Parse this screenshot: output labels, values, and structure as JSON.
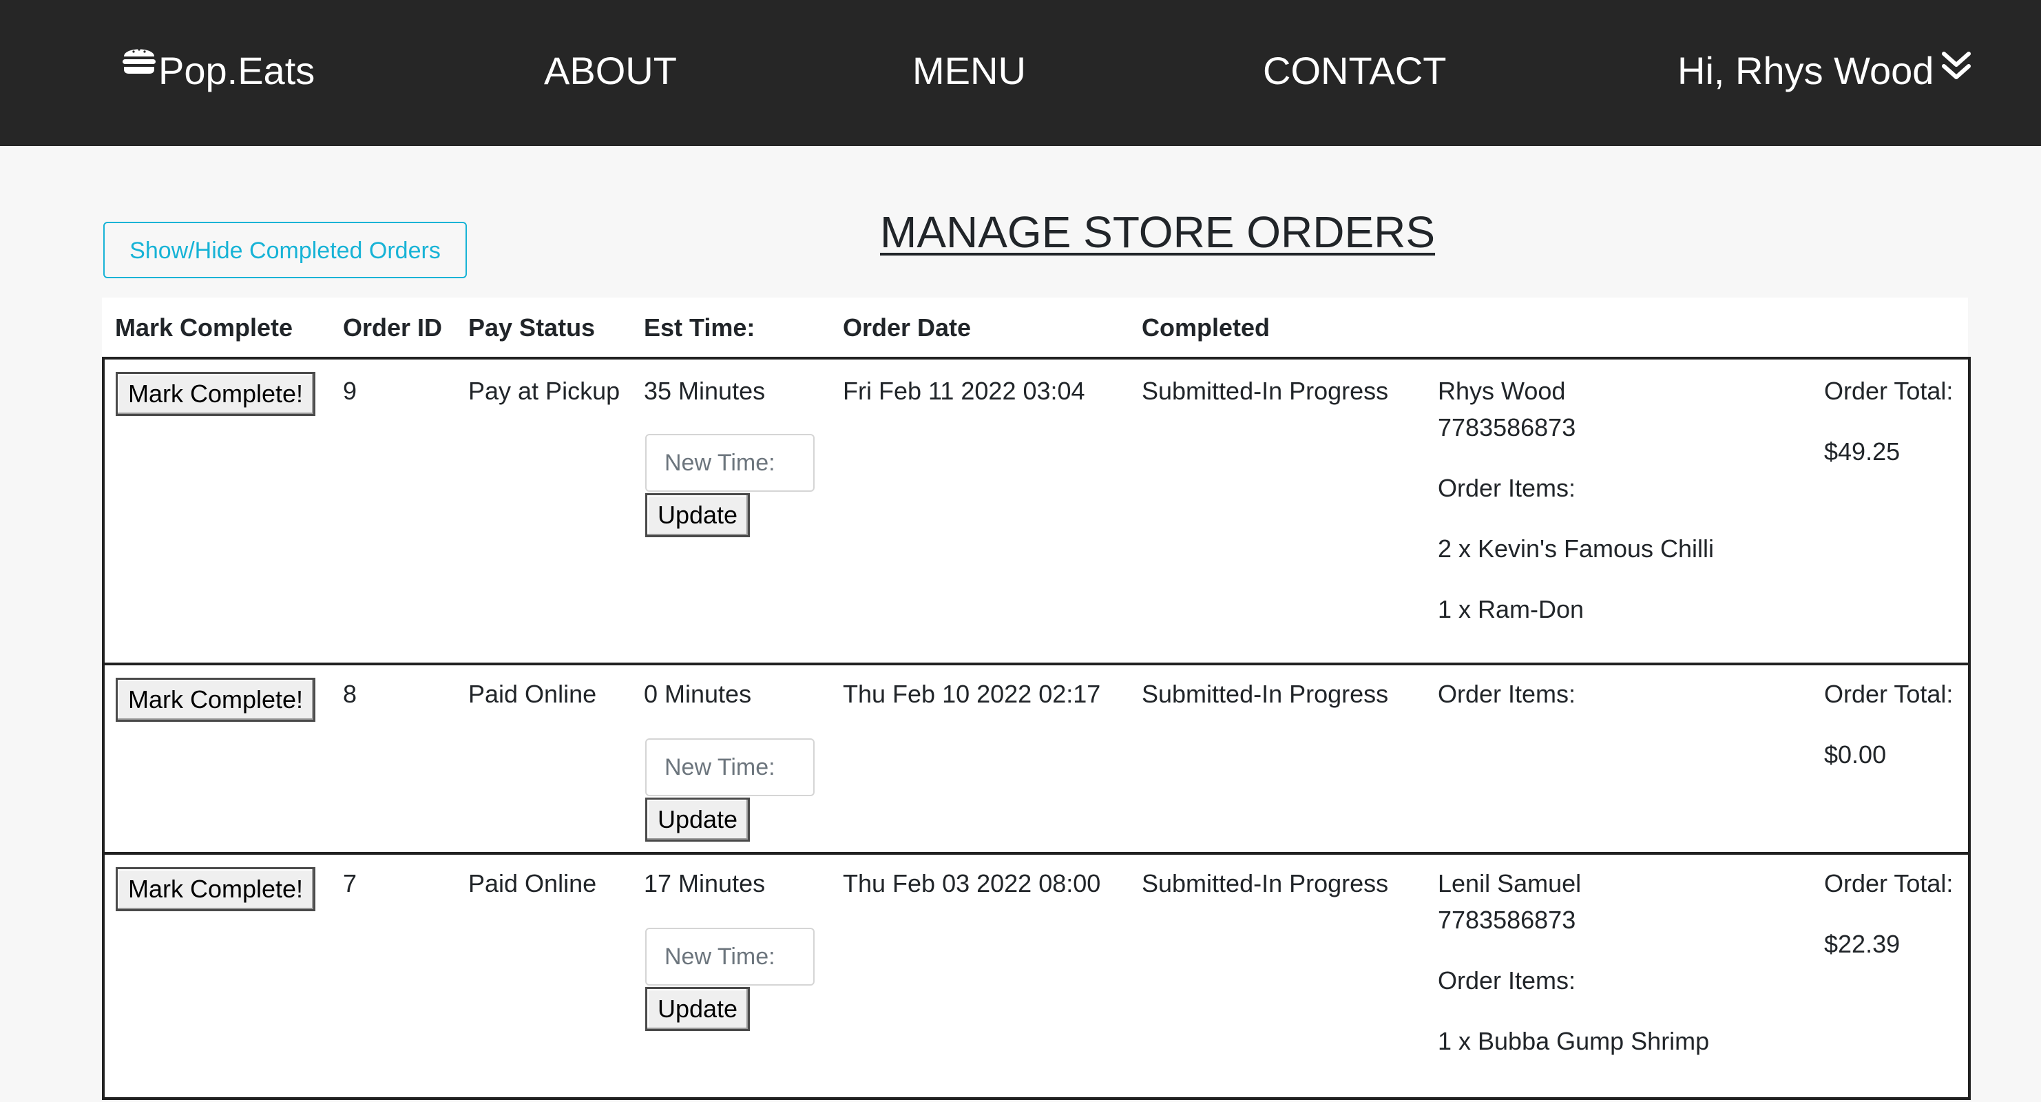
{
  "nav": {
    "brand": "Pop.Eats",
    "about": "ABOUT",
    "menu": "MENU",
    "contact": "CONTACT",
    "user": "Hi, Rhys Wood"
  },
  "page": {
    "toggle_label": "Show/Hide Completed Orders",
    "title": "MANAGE STORE ORDERS"
  },
  "table": {
    "headers": [
      "Mark Complete",
      "Order ID",
      "Pay Status",
      "Est Time:",
      "Order Date",
      "Completed"
    ]
  },
  "orders": [
    {
      "mark_label": "Mark Complete!",
      "id": "9",
      "pay_status": "Pay at Pickup",
      "est_time": "35 Minutes",
      "new_time_placeholder": "New Time:",
      "update_label": "Update",
      "date": "Fri Feb 11 2022 03:04",
      "status": "Submitted-In Progress",
      "customer_name": "Rhys Wood",
      "customer_phone": "7783586873",
      "items_label": "Order Items:",
      "items": [
        "2 x Kevin's Famous Chilli",
        "1 x Ram-Don"
      ],
      "total_label": "Order Total:",
      "total": "$49.25"
    },
    {
      "mark_label": "Mark Complete!",
      "id": "8",
      "pay_status": "Paid Online",
      "est_time": "0 Minutes",
      "new_time_placeholder": "New Time:",
      "update_label": "Update",
      "date": "Thu Feb 10 2022 02:17",
      "status": "Submitted-In Progress",
      "items_label": "Order Items:",
      "items": [],
      "total_label": "Order Total:",
      "total": "$0.00"
    },
    {
      "mark_label": "Mark Complete!",
      "id": "7",
      "pay_status": "Paid Online",
      "est_time": "17 Minutes",
      "new_time_placeholder": "New Time:",
      "update_label": "Update",
      "date": "Thu Feb 03 2022 08:00",
      "status": "Submitted-In Progress",
      "customer_name": "Lenil Samuel",
      "customer_phone": "7783586873",
      "items_label": "Order Items:",
      "items": [
        "1 x Bubba Gump Shrimp"
      ],
      "total_label": "Order Total:",
      "total": "$22.39"
    }
  ],
  "icons": {
    "brand": "burger-icon",
    "user_menu": "double-chevron-down-icon"
  },
  "colors": {
    "navbar": "#262626",
    "accent": "#17b3d6",
    "background": "#f7f7f7"
  }
}
